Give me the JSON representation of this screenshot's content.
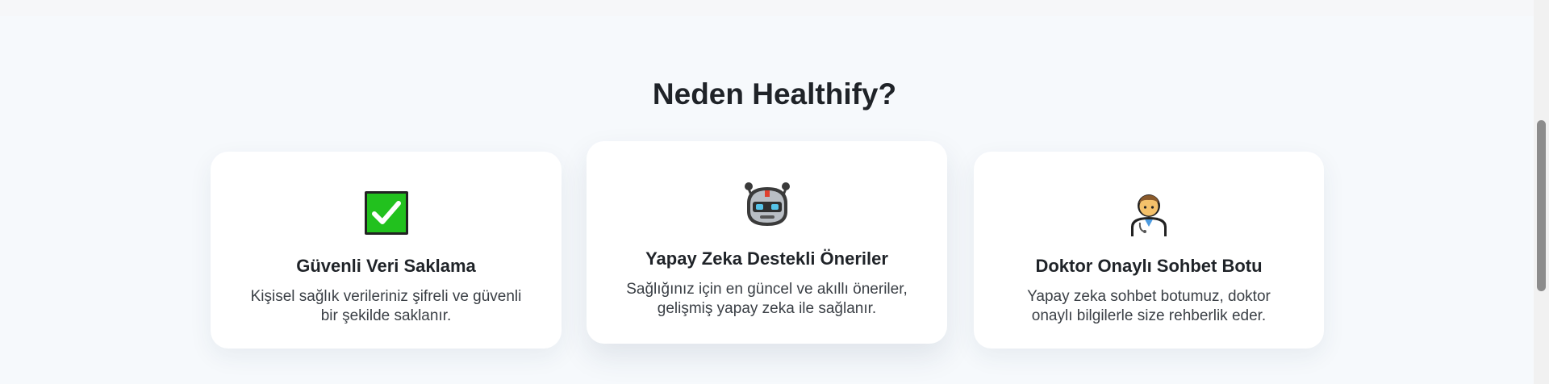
{
  "section": {
    "title": "Neden Healthify?"
  },
  "features": [
    {
      "icon": "checkmark-icon",
      "title": "Güvenli Veri Saklama",
      "desc_line1": "Kişisel sağlık verileriniz şifreli ve güvenli",
      "desc_line2": "bir şekilde saklanır."
    },
    {
      "icon": "robot-icon",
      "title": "Yapay Zeka Destekli Öneriler",
      "desc_line1": "Sağlığınız için en güncel ve akıllı öneriler,",
      "desc_line2": "gelişmiş yapay zeka ile sağlanır."
    },
    {
      "icon": "doctor-icon",
      "title": "Doktor Onaylı Sohbet Botu",
      "desc_line1": "Yapay zeka sohbet botumuz, doktor",
      "desc_line2": "onaylı bilgilerle size rehberlik eder."
    }
  ],
  "colors": {
    "check_green": "#22c11e",
    "robot_gray": "#9aa0a6",
    "doctor_skin": "#f4c16b"
  }
}
